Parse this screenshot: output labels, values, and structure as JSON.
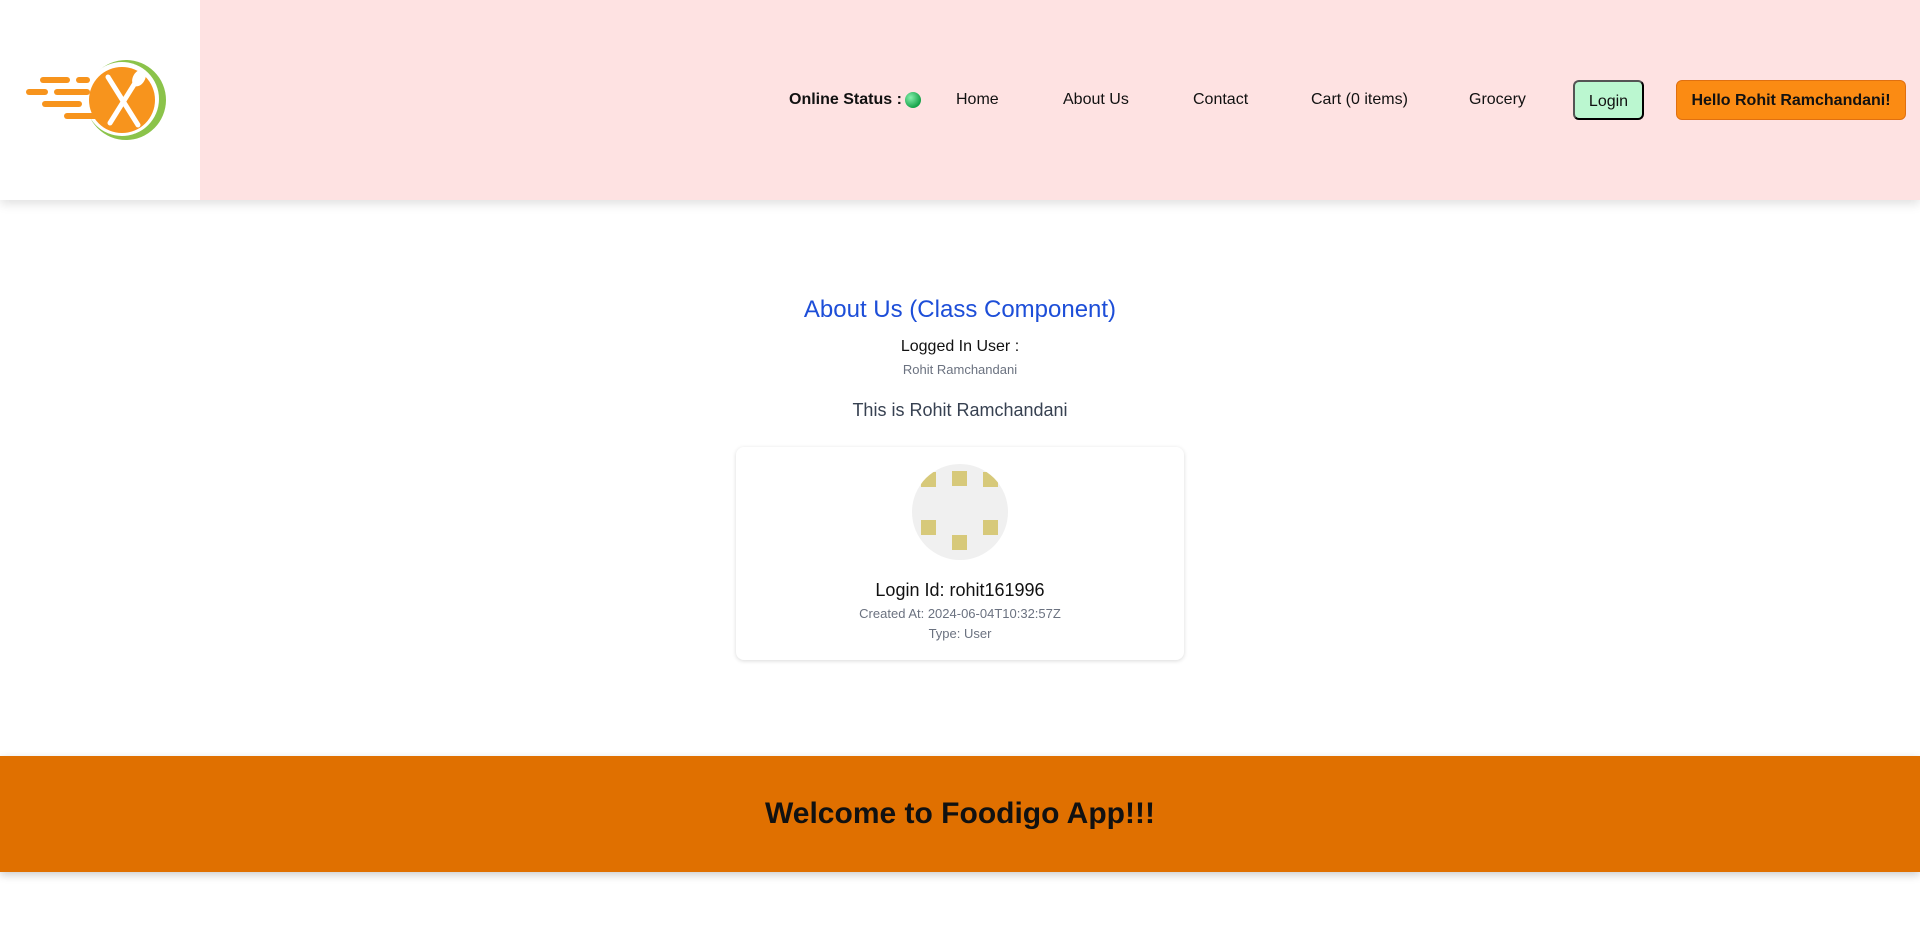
{
  "header": {
    "logo": "foodigo-logo-icon",
    "online_status_label": "Online Status :",
    "online_status_color": "#22c55e",
    "nav": {
      "home": "Home",
      "about": "About Us",
      "contact": "Contact",
      "cart": "Cart (0 items)",
      "grocery": "Grocery"
    },
    "login_label": "Login",
    "hello_label": "Hello Rohit Ramchandani!"
  },
  "main": {
    "title": "About Us (Class Component)",
    "logged_in_label": "Logged In User :",
    "logged_in_name": "Rohit Ramchandani",
    "intro": "This is Rohit Ramchandani",
    "card": {
      "avatar": "identicon-avatar",
      "login_id": "Login Id: rohit161996",
      "created_at": "Created At: 2024-06-04T10:32:57Z",
      "type": "Type: User"
    }
  },
  "footer": {
    "text": "Welcome to Foodigo App!!!"
  },
  "colors": {
    "header_bg": "#fee2e2",
    "accent_orange": "#fb8b13",
    "footer_bg": "#e07000",
    "title_blue": "#1d4ed8",
    "login_bg": "#bbf7d0"
  }
}
